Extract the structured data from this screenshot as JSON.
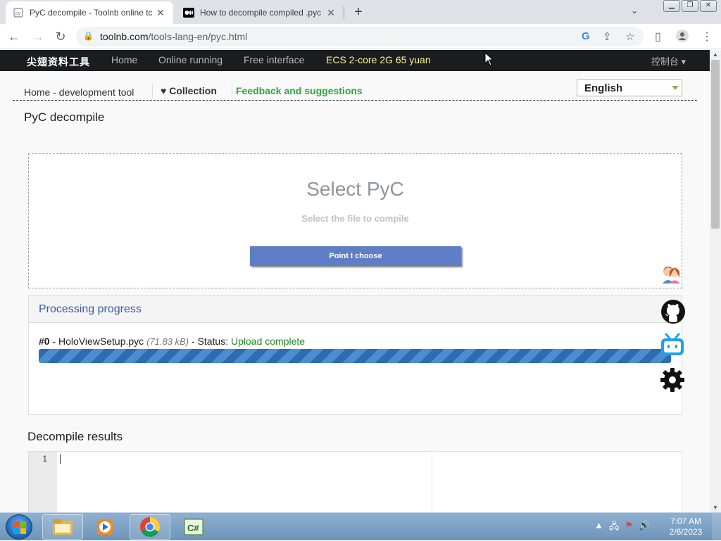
{
  "browser": {
    "tabs": [
      {
        "title": "PyC decompile - Toolnb online tc",
        "active": true
      },
      {
        "title": "How to decompile compiled .pyc",
        "active": false
      }
    ],
    "new_tab": "+",
    "url_host": "toolnb.com",
    "url_path": "/tools-lang-en/pyc.html"
  },
  "topnav": {
    "logo": "尖翅资料工具",
    "links": [
      "Home",
      "Online running",
      "Free interface",
      "ECS 2-core 2G 65 yuan"
    ],
    "console": "控制台",
    "console_caret": "▾"
  },
  "crumbs": {
    "home": "Home - development tool",
    "collection_heart": "♥",
    "collection": "Collection",
    "feedback": "Feedback and suggestions",
    "language": "English"
  },
  "page": {
    "title": "PyC decompile",
    "dropzone_title": "Select PyC",
    "dropzone_sub": "Select the file to compile",
    "pick_button": "Point I choose"
  },
  "progress": {
    "heading": "Processing progress",
    "item_index": "#0",
    "sep1": " - ",
    "filename": "HoloViewSetup.pyc",
    "size": "(71.83 kB)",
    "status_label": " - Status: ",
    "status_value": "Upload complete",
    "fraction": 1.0
  },
  "results": {
    "heading": "Decompile results",
    "line_number": "1"
  },
  "taskbar": {
    "time": "7:07 AM",
    "date": "2/6/2023"
  },
  "colors": {
    "feedback_green": "#2ea73c",
    "status_green": "#1f8b24",
    "button_blue": "#5f7ec5",
    "progress_blue": "#2f6bb0",
    "ecs_yellow": "#f8f49a"
  }
}
